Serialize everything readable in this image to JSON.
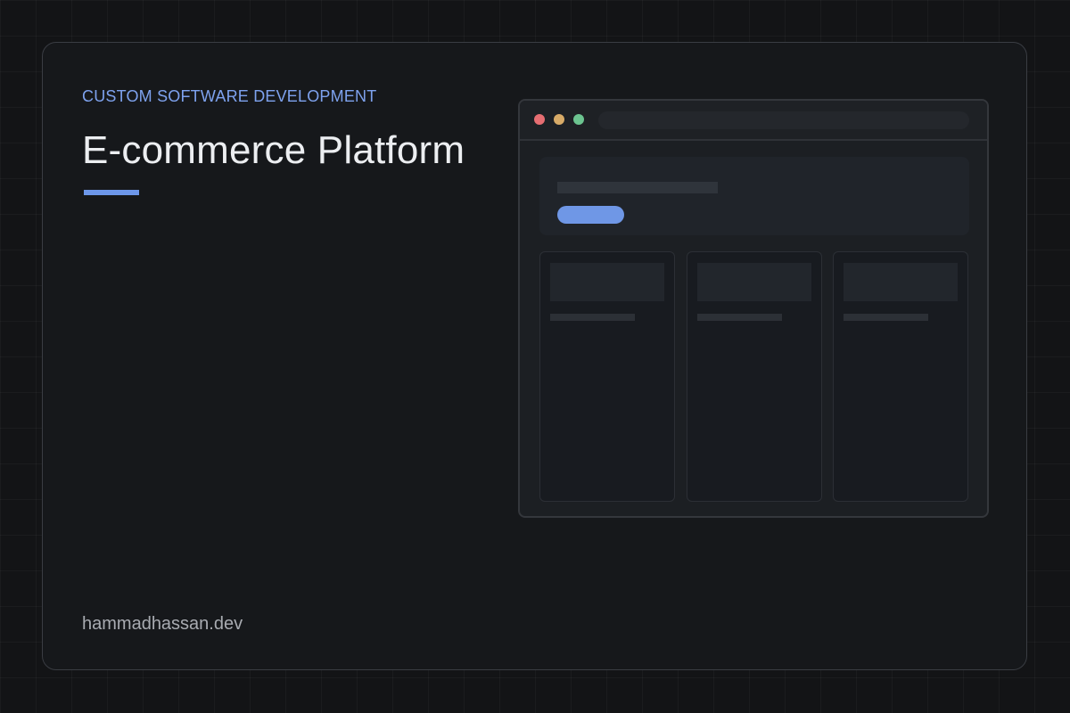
{
  "eyebrow": "CUSTOM SOFTWARE DEVELOPMENT",
  "title": "E-commerce Platform",
  "footer": "hammadhassan.dev",
  "colors": {
    "background": "#131416",
    "card": "#16181b",
    "accent": "#6d97ea",
    "eyebrow_text": "#7ea2ee",
    "title_text": "#eceef1",
    "footer_text": "#a8abb1",
    "window_dot_red": "#e66e72",
    "window_dot_yellow": "#d8ab68",
    "window_dot_green": "#6cc490"
  },
  "mockup": {
    "icons": [
      "close-dot-icon",
      "minimize-dot-icon",
      "maximize-dot-icon"
    ],
    "product_cards": 3
  }
}
